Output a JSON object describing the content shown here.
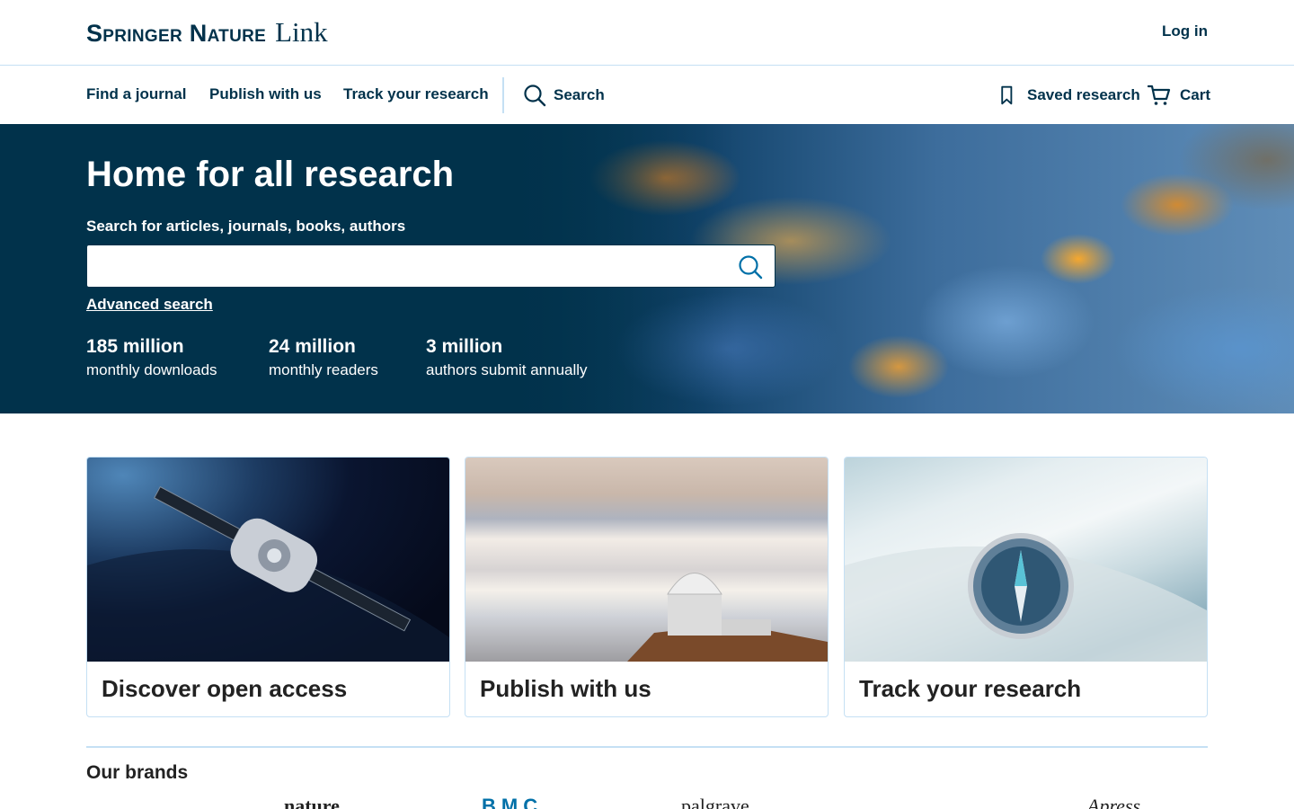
{
  "header": {
    "brand_main": "Springer Nature",
    "brand_link": "Link",
    "login_label": "Log in"
  },
  "nav": {
    "items": [
      {
        "label": "Find a journal"
      },
      {
        "label": "Publish with us"
      },
      {
        "label": "Track your research"
      }
    ],
    "search_label": "Search",
    "saved_label": "Saved research",
    "cart_label": "Cart"
  },
  "hero": {
    "title": "Home for all research",
    "search_label": "Search for articles, journals, books, authors",
    "search_value": "",
    "advanced_label": "Advanced search",
    "stats": [
      {
        "value": "185 million",
        "label": "monthly downloads"
      },
      {
        "value": "24 million",
        "label": "monthly readers"
      },
      {
        "value": "3 million",
        "label": "authors submit annually"
      }
    ]
  },
  "cards": [
    {
      "title": "Discover open access"
    },
    {
      "title": "Publish with us"
    },
    {
      "title": "Track your research"
    }
  ],
  "brands": {
    "title": "Our brands",
    "logos": [
      "nature",
      "BMC",
      "palgrave",
      "Apress"
    ]
  },
  "colors": {
    "primary": "#01324b",
    "accent": "#0070a8",
    "divider": "#c5e0f4"
  }
}
